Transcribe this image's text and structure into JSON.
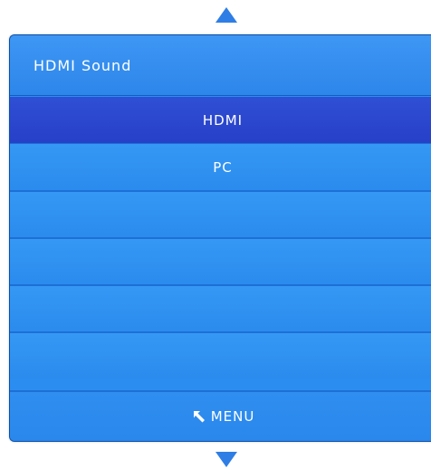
{
  "dialog": {
    "title": "HDMI Sound"
  },
  "options": [
    {
      "label": "HDMI",
      "selected": true
    },
    {
      "label": "PC",
      "selected": false
    },
    {
      "label": "",
      "selected": false
    },
    {
      "label": "",
      "selected": false
    },
    {
      "label": "",
      "selected": false
    },
    {
      "label": "",
      "selected": false
    }
  ],
  "footer": {
    "back_icon": "return-arrow-icon",
    "menu_label": "MENU"
  },
  "navigation": {
    "up_icon": "triangle-up-icon",
    "down_icon": "triangle-down-icon"
  },
  "colors": {
    "panel": "#2b8df0",
    "selected_row": "#2f4fd4",
    "text": "#ffffff",
    "arrows": "#2f7ee5"
  }
}
